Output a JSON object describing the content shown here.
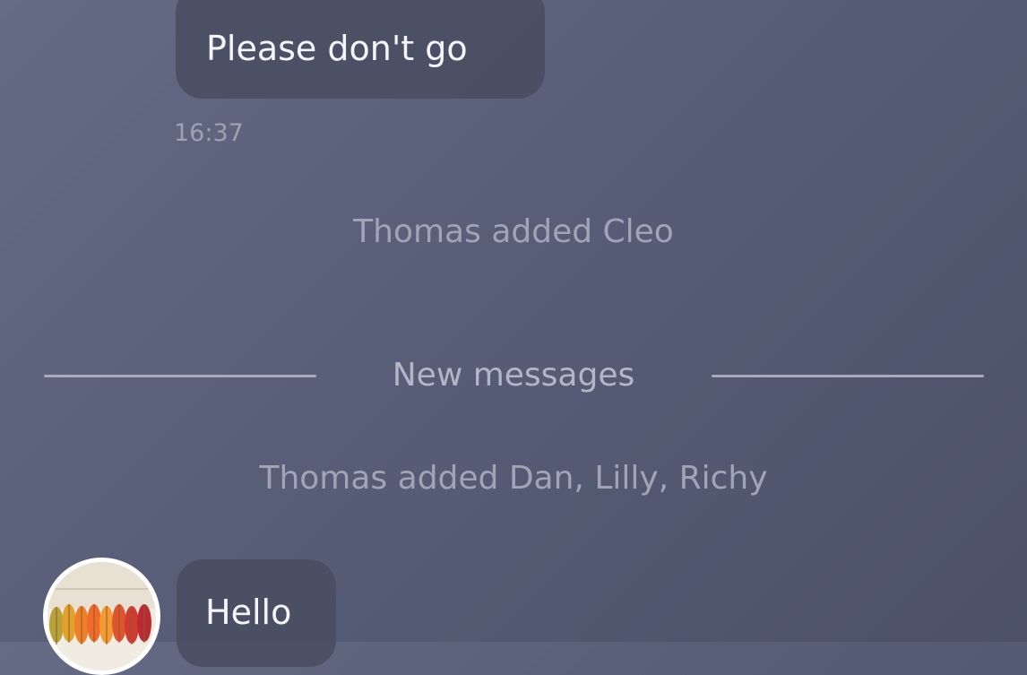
{
  "messages": [
    {
      "text": "Please don't go",
      "time": "16:37"
    },
    {
      "text": "Hello"
    }
  ],
  "system_events": [
    "Thomas added Cleo",
    "Thomas added Dan, Lilly, Richy"
  ],
  "divider": {
    "label": "New messages"
  },
  "avatar": {
    "icon": "autumn-leaves-avatar"
  }
}
